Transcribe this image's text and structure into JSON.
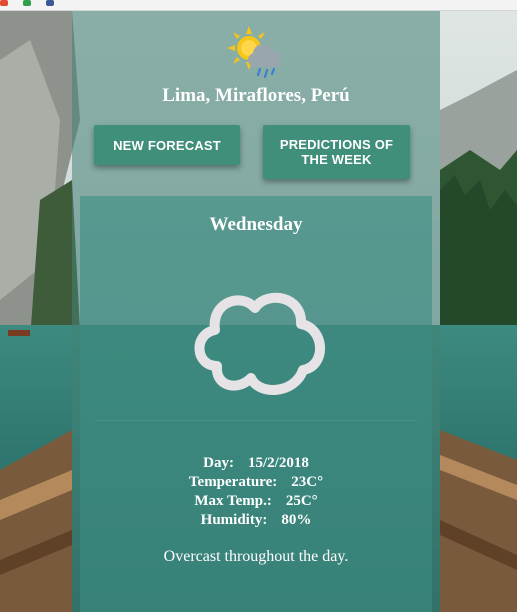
{
  "location": "Lima, Miraflores, Perú",
  "buttons": {
    "new_forecast": "NEW FORECAST",
    "predictions": "PREDICTIONS OF THE WEEK"
  },
  "forecast": {
    "day_name": "Wednesday",
    "condition_icon": "cloud-icon",
    "details": [
      {
        "label": "Day:",
        "value": "15/2/2018"
      },
      {
        "label": "Temperature:",
        "value": "23C°"
      },
      {
        "label": "Max Temp.:",
        "value": "25C°"
      },
      {
        "label": "Humidity:",
        "value": "80%"
      }
    ],
    "summary": "Overcast throughout the day."
  },
  "colors": {
    "accent": "#3f8f7a",
    "panel": "#4a8276",
    "card": "#3c8c82",
    "sun": "#f5c518",
    "cloud_outline": "#e6e3e6"
  }
}
